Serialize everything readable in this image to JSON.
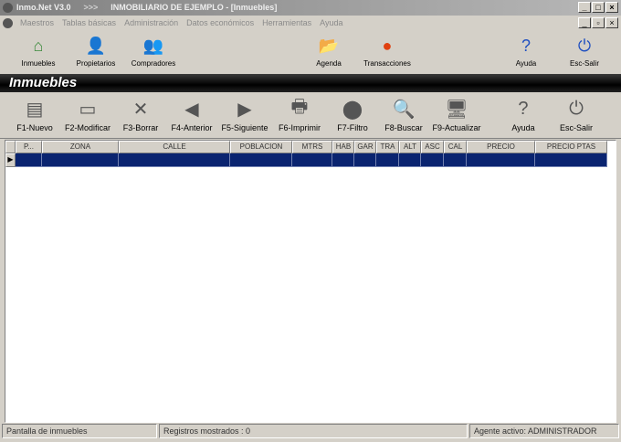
{
  "window": {
    "app": "Inmo.Net V3.0",
    "separator": ">>>",
    "title": "INMOBILIARIO DE EJEMPLO - [Inmuebles]",
    "min": "_",
    "max": "□",
    "close": "×",
    "restore": "▫"
  },
  "menu": [
    "Maestros",
    "Tablas básicas",
    "Administración",
    "Datos económicos",
    "Herramientas",
    "Ayuda"
  ],
  "iconbar": [
    {
      "label": "Inmuebles",
      "icon": "house-icon",
      "glyph": "⌂",
      "color": "#3a8a3a"
    },
    {
      "label": "Propietarios",
      "icon": "owner-icon",
      "glyph": "👤",
      "color": "#2a4aa0"
    },
    {
      "label": "Compradores",
      "icon": "buyers-icon",
      "glyph": "👥",
      "color": "#c06020"
    },
    {
      "label": "Agenda",
      "icon": "folder-icon",
      "glyph": "📂",
      "color": "#e0b030"
    },
    {
      "label": "Transacciones",
      "icon": "transactions-icon",
      "glyph": "●",
      "color": "#e04010"
    },
    {
      "label": "Ayuda",
      "icon": "help-icon",
      "glyph": "?",
      "color": "#2050c0"
    },
    {
      "label": "Esc-Salir",
      "icon": "power-icon",
      "glyph": "⏻",
      "color": "#2050c0"
    }
  ],
  "section_title": "Inmuebles",
  "toolbar": [
    {
      "label": "F1-Nuevo",
      "icon": "new-icon",
      "glyph": "▤"
    },
    {
      "label": "F2-Modificar",
      "icon": "edit-icon",
      "glyph": "▭"
    },
    {
      "label": "F3-Borrar",
      "icon": "delete-icon",
      "glyph": "✕"
    },
    {
      "label": "F4-Anterior",
      "icon": "previous-icon",
      "glyph": "◀"
    },
    {
      "label": "F5-Siguiente",
      "icon": "next-icon",
      "glyph": "▶"
    },
    {
      "label": "F6-Imprimir",
      "icon": "printer-icon",
      "glyph": "🖶"
    },
    {
      "label": "F7-Filtro",
      "icon": "filter-icon",
      "glyph": "⬤"
    },
    {
      "label": "F8-Buscar",
      "icon": "search-icon",
      "glyph": "🔍"
    },
    {
      "label": "F9-Actualizar",
      "icon": "refresh-icon",
      "glyph": "🖥"
    },
    {
      "label": "Ayuda",
      "icon": "help-icon",
      "glyph": "?"
    },
    {
      "label": "Esc-Salir",
      "icon": "power-icon",
      "glyph": "⏻"
    }
  ],
  "grid": {
    "columns": [
      "P...",
      "ZONA",
      "CALLE",
      "POBLACION",
      "MTRS",
      "HAB",
      "GAR",
      "TRA",
      "ALT",
      "ASC",
      "CAL",
      "PRECIO",
      "PRECIO PTAS"
    ],
    "row_indicator": "▶"
  },
  "status": {
    "left": "Pantalla de inmuebles",
    "middle": "Registros mostrados : 0",
    "right": "Agente activo: ADMINISTRADOR"
  }
}
